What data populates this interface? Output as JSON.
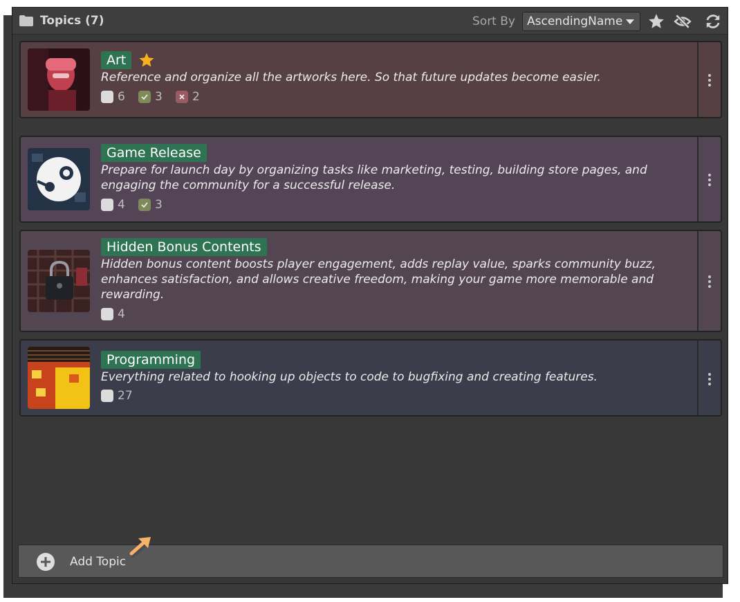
{
  "header": {
    "title": "Topics (7)",
    "sort_label": "Sort By",
    "sort_value": "AscendingName",
    "icons": [
      "folder-icon",
      "star-icon",
      "eye-off-icon",
      "refresh-icon"
    ]
  },
  "topics": [
    {
      "name": "Art",
      "favorite": true,
      "description": "Reference and organize all the artworks here. So that future updates become easier.",
      "total": "6",
      "done": "3",
      "failed": "2",
      "bg": "#574043"
    },
    {
      "name": "Game Release",
      "favorite": false,
      "description": "Prepare for launch day by organizing tasks like marketing, testing, building store pages, and engaging the community for a successful release.",
      "total": "4",
      "done": "3",
      "bg": "#544556"
    },
    {
      "name": "Hidden Bonus Contents",
      "favorite": false,
      "description": "Hidden bonus content boosts player engagement, adds replay value, sparks community buzz, enhances satisfaction, and allows creative freedom, making your game more memorable and rewarding.",
      "total": "4",
      "bg": "#534552"
    },
    {
      "name": "Programming",
      "favorite": false,
      "description": "Everything related to hooking up objects to code to bugfixing and creating features.",
      "total": "27",
      "bg": "#3c3d4a"
    }
  ],
  "footer": {
    "add_label": "Add Topic"
  },
  "colors": {
    "tag": "#2f7452",
    "star": "#f5b21e",
    "done": "#7e8a5a",
    "failed": "#9a5a62",
    "arrow": "#f6b26b"
  }
}
